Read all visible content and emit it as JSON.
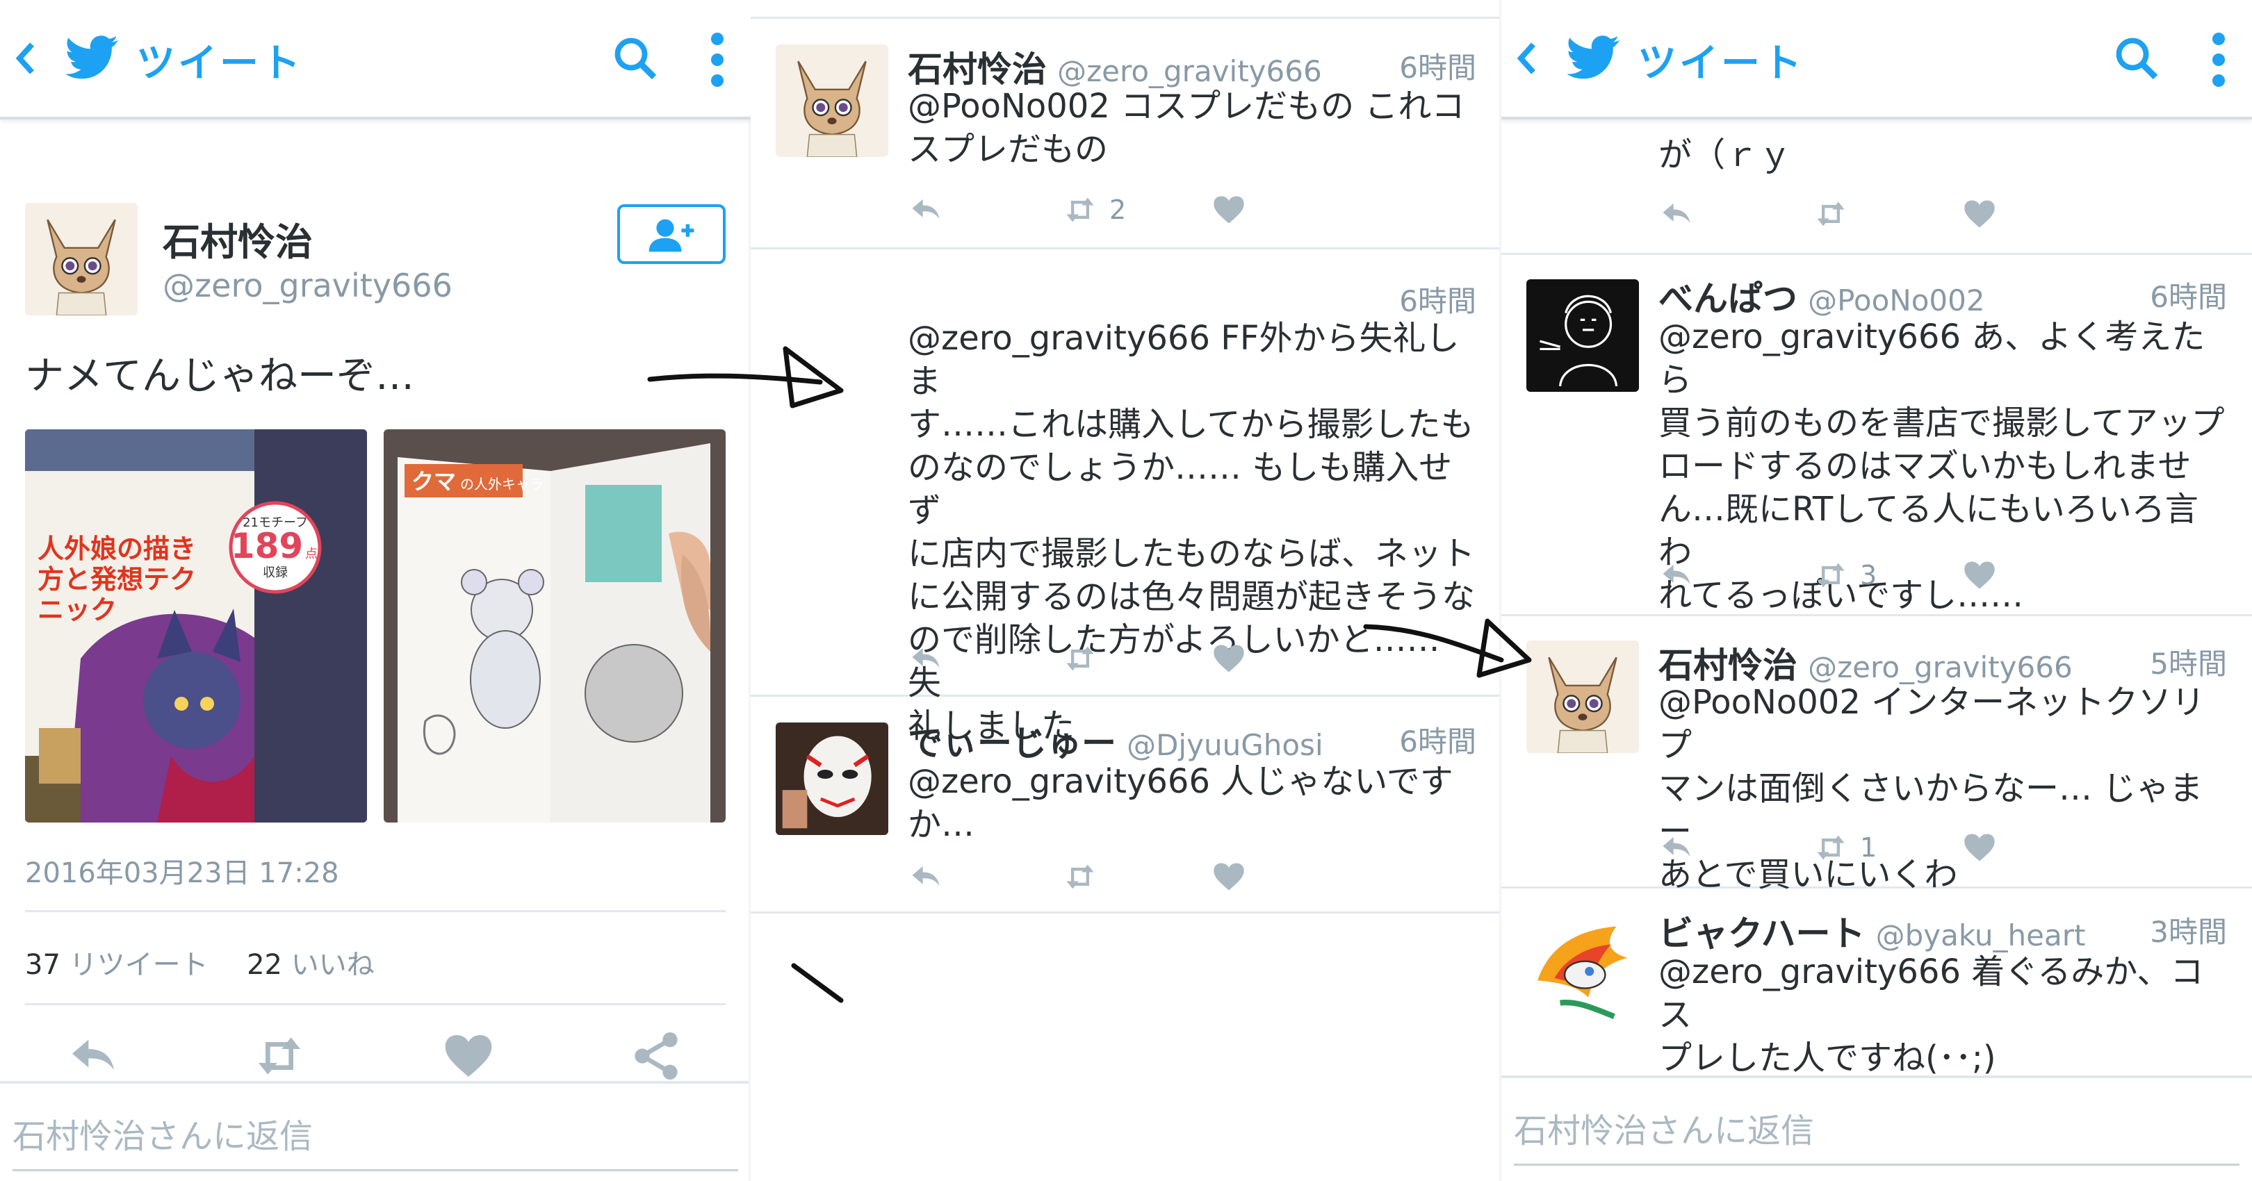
{
  "colors": {
    "accent": "#1da1f2",
    "muted": "#8899a6",
    "text": "#292f33",
    "border": "#e1e8ed"
  },
  "header": {
    "title": "ツイート"
  },
  "main_tweet": {
    "name": "石村怜治",
    "handle": "@zero_gravity666",
    "text": "ナメてんじゃねーぞ…",
    "date": "2016年03月23日 17:28",
    "retweets": "37",
    "retweets_label": "リツイート",
    "likes": "22",
    "likes_label": "いいね",
    "photo1": {
      "main": "人外娘の描き方と発想テクニック",
      "badge_top": "21モチーフ",
      "badge_num": "189",
      "badge_unit": "点",
      "badge_bottom": "収録"
    },
    "photo2": {
      "title": "クマ",
      "subtitle": "の人外キャラ"
    }
  },
  "reply_placeholder": "石村怜治さんに返信",
  "panel2": {
    "tweets": [
      {
        "name": "石村怜治",
        "handle": "@zero_gravity666",
        "time": "6時間",
        "lines": [
          "@PooNo002 コスプレだもの これコ",
          "スプレだもの"
        ],
        "retweets": "2",
        "likes": ""
      },
      {
        "name": "",
        "handle": "",
        "time": "6時間",
        "lines": [
          "@zero_gravity666 FF外から失礼しま",
          "す……これは購入してから撮影したも",
          "のなのでしょうか…… もしも購入せず",
          "に店内で撮影したものならば、ネット",
          "に公開するのは色々問題が起きそうな",
          "ので削除した方がよろしいかと…… 失",
          "礼しました"
        ],
        "retweets": "",
        "likes": ""
      },
      {
        "name": "でぃーじゅー",
        "handle": "@DjyuuGhosi",
        "time": "6時間",
        "lines": [
          "@zero_gravity666 人じゃないですか…"
        ],
        "retweets": "",
        "likes": ""
      }
    ]
  },
  "panel3": {
    "partial_tweet": {
      "lines": [
        "が（ｒｙ"
      ],
      "retweets": "",
      "likes": ""
    },
    "tweets": [
      {
        "name": "べんぱつ",
        "handle": "@PooNo002",
        "time": "6時間",
        "lines": [
          "@zero_gravity666 あ、よく考えたら",
          "買う前のものを書店で撮影してアップ",
          "ロードするのはマズいかもしれませ",
          "ん…既にRTしてる人にもいろいろ言わ",
          "れてるっぽいですし……"
        ],
        "retweets": "3",
        "likes": ""
      },
      {
        "name": "石村怜治",
        "handle": "@zero_gravity666",
        "time": "5時間",
        "lines": [
          "@PooNo002 インターネットクソリプ",
          "マンは面倒くさいからなー… じゃまー",
          "あとで買いにいくわ"
        ],
        "retweets": "1",
        "likes": ""
      },
      {
        "name": "ビャクハート",
        "handle": "@byaku_heart",
        "time": "3時間",
        "lines": [
          "@zero_gravity666 着ぐるみか、コス",
          "プレした人ですね(･･;)"
        ],
        "retweets": "",
        "likes": ""
      }
    ]
  }
}
